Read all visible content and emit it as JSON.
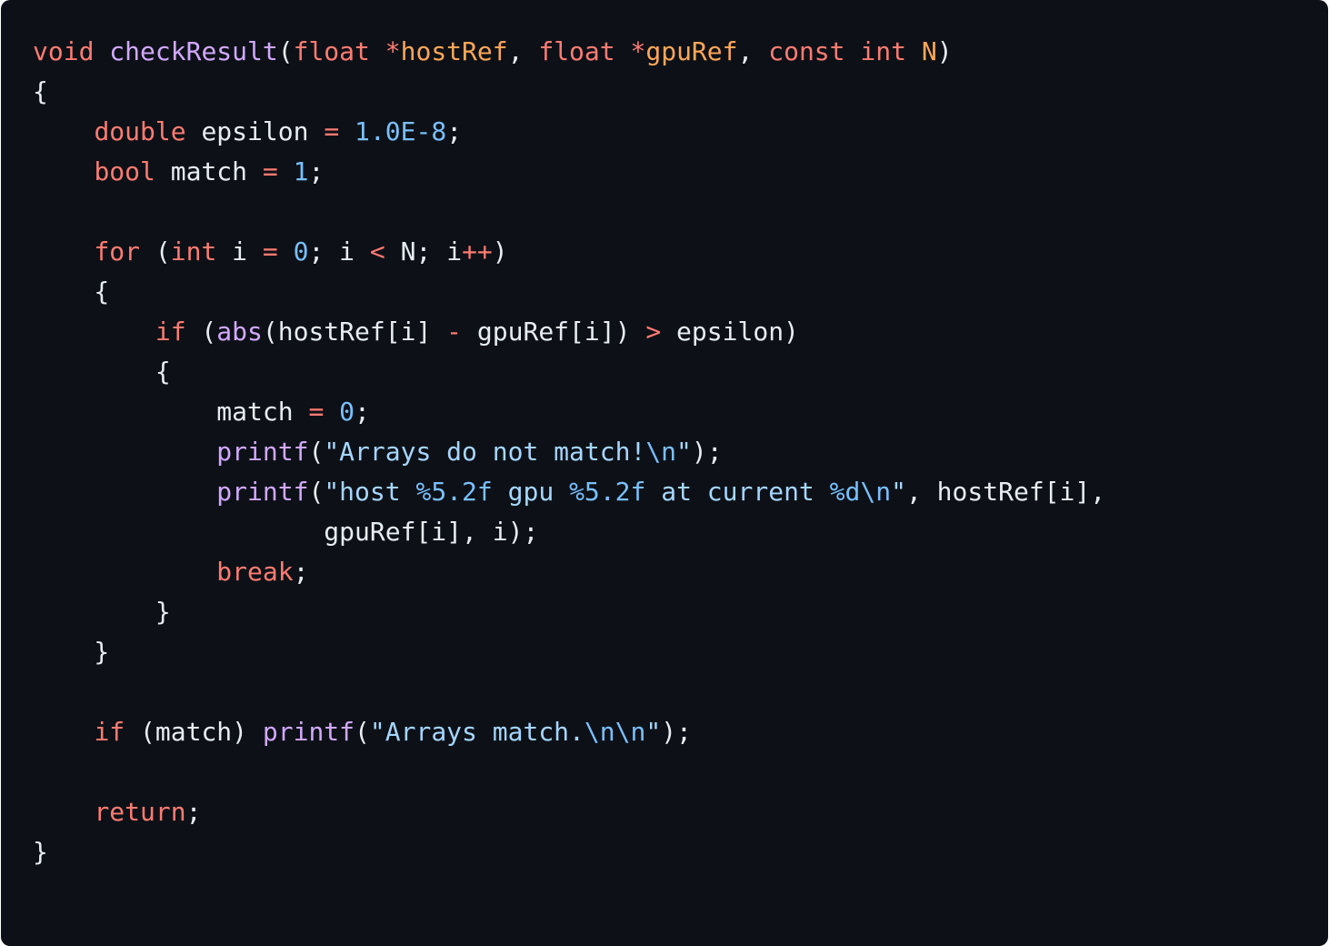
{
  "editor": {
    "language": "c",
    "colors": {
      "background": "#0d1117",
      "plain": "#e6edf3",
      "keyword": "#ff7b72",
      "function": "#d2a8ff",
      "parameter": "#ffa657",
      "number": "#79c0ff",
      "string": "#a5d6ff",
      "operator": "#ff7b72"
    },
    "lines": [
      {
        "tokens": [
          {
            "t": "void",
            "k": "keyword"
          },
          {
            "t": " ",
            "k": "plain"
          },
          {
            "t": "checkResult",
            "k": "function"
          },
          {
            "t": "(",
            "k": "plain"
          },
          {
            "t": "float",
            "k": "keyword"
          },
          {
            "t": " ",
            "k": "plain"
          },
          {
            "t": "*",
            "k": "operator"
          },
          {
            "t": "hostRef",
            "k": "parameter"
          },
          {
            "t": ", ",
            "k": "plain"
          },
          {
            "t": "float",
            "k": "keyword"
          },
          {
            "t": " ",
            "k": "plain"
          },
          {
            "t": "*",
            "k": "operator"
          },
          {
            "t": "gpuRef",
            "k": "parameter"
          },
          {
            "t": ", ",
            "k": "plain"
          },
          {
            "t": "const",
            "k": "keyword"
          },
          {
            "t": " ",
            "k": "plain"
          },
          {
            "t": "int",
            "k": "keyword"
          },
          {
            "t": " ",
            "k": "plain"
          },
          {
            "t": "N",
            "k": "parameter"
          },
          {
            "t": ")",
            "k": "plain"
          }
        ]
      },
      {
        "tokens": [
          {
            "t": "{",
            "k": "plain"
          }
        ]
      },
      {
        "tokens": [
          {
            "t": "    ",
            "k": "plain"
          },
          {
            "t": "double",
            "k": "keyword"
          },
          {
            "t": " epsilon ",
            "k": "plain"
          },
          {
            "t": "=",
            "k": "operator"
          },
          {
            "t": " ",
            "k": "plain"
          },
          {
            "t": "1.0E-8",
            "k": "number"
          },
          {
            "t": ";",
            "k": "plain"
          }
        ]
      },
      {
        "tokens": [
          {
            "t": "    ",
            "k": "plain"
          },
          {
            "t": "bool",
            "k": "keyword"
          },
          {
            "t": " match ",
            "k": "plain"
          },
          {
            "t": "=",
            "k": "operator"
          },
          {
            "t": " ",
            "k": "plain"
          },
          {
            "t": "1",
            "k": "number"
          },
          {
            "t": ";",
            "k": "plain"
          }
        ]
      },
      {
        "tokens": []
      },
      {
        "tokens": [
          {
            "t": "    ",
            "k": "plain"
          },
          {
            "t": "for",
            "k": "keyword"
          },
          {
            "t": " (",
            "k": "plain"
          },
          {
            "t": "int",
            "k": "keyword"
          },
          {
            "t": " i ",
            "k": "plain"
          },
          {
            "t": "=",
            "k": "operator"
          },
          {
            "t": " ",
            "k": "plain"
          },
          {
            "t": "0",
            "k": "number"
          },
          {
            "t": "; i ",
            "k": "plain"
          },
          {
            "t": "<",
            "k": "operator"
          },
          {
            "t": " N; i",
            "k": "plain"
          },
          {
            "t": "++",
            "k": "operator"
          },
          {
            "t": ")",
            "k": "plain"
          }
        ]
      },
      {
        "tokens": [
          {
            "t": "    {",
            "k": "plain"
          }
        ]
      },
      {
        "tokens": [
          {
            "t": "        ",
            "k": "plain"
          },
          {
            "t": "if",
            "k": "keyword"
          },
          {
            "t": " (",
            "k": "plain"
          },
          {
            "t": "abs",
            "k": "function"
          },
          {
            "t": "(hostRef[i] ",
            "k": "plain"
          },
          {
            "t": "-",
            "k": "operator"
          },
          {
            "t": " gpuRef[i]) ",
            "k": "plain"
          },
          {
            "t": ">",
            "k": "operator"
          },
          {
            "t": " epsilon)",
            "k": "plain"
          }
        ]
      },
      {
        "tokens": [
          {
            "t": "        {",
            "k": "plain"
          }
        ]
      },
      {
        "tokens": [
          {
            "t": "            match ",
            "k": "plain"
          },
          {
            "t": "=",
            "k": "operator"
          },
          {
            "t": " ",
            "k": "plain"
          },
          {
            "t": "0",
            "k": "number"
          },
          {
            "t": ";",
            "k": "plain"
          }
        ]
      },
      {
        "tokens": [
          {
            "t": "            ",
            "k": "plain"
          },
          {
            "t": "printf",
            "k": "function"
          },
          {
            "t": "(",
            "k": "plain"
          },
          {
            "t": "\"Arrays do not match!",
            "k": "string"
          },
          {
            "t": "\\n",
            "k": "number"
          },
          {
            "t": "\"",
            "k": "string"
          },
          {
            "t": ");",
            "k": "plain"
          }
        ]
      },
      {
        "tokens": [
          {
            "t": "            ",
            "k": "plain"
          },
          {
            "t": "printf",
            "k": "function"
          },
          {
            "t": "(",
            "k": "plain"
          },
          {
            "t": "\"host ",
            "k": "string"
          },
          {
            "t": "%5.2f",
            "k": "number"
          },
          {
            "t": " gpu ",
            "k": "string"
          },
          {
            "t": "%5.2f",
            "k": "number"
          },
          {
            "t": " at current ",
            "k": "string"
          },
          {
            "t": "%d",
            "k": "number"
          },
          {
            "t": "\\n",
            "k": "number"
          },
          {
            "t": "\"",
            "k": "string"
          },
          {
            "t": ", hostRef[i],",
            "k": "plain"
          }
        ]
      },
      {
        "tokens": [
          {
            "t": "                   gpuRef[i], i);",
            "k": "plain"
          }
        ]
      },
      {
        "tokens": [
          {
            "t": "            ",
            "k": "plain"
          },
          {
            "t": "break",
            "k": "keyword"
          },
          {
            "t": ";",
            "k": "plain"
          }
        ]
      },
      {
        "tokens": [
          {
            "t": "        }",
            "k": "plain"
          }
        ]
      },
      {
        "tokens": [
          {
            "t": "    }",
            "k": "plain"
          }
        ]
      },
      {
        "tokens": []
      },
      {
        "tokens": [
          {
            "t": "    ",
            "k": "plain"
          },
          {
            "t": "if",
            "k": "keyword"
          },
          {
            "t": " (match) ",
            "k": "plain"
          },
          {
            "t": "printf",
            "k": "function"
          },
          {
            "t": "(",
            "k": "plain"
          },
          {
            "t": "\"Arrays match.",
            "k": "string"
          },
          {
            "t": "\\n\\n",
            "k": "number"
          },
          {
            "t": "\"",
            "k": "string"
          },
          {
            "t": ");",
            "k": "plain"
          }
        ]
      },
      {
        "tokens": []
      },
      {
        "tokens": [
          {
            "t": "    ",
            "k": "plain"
          },
          {
            "t": "return",
            "k": "keyword"
          },
          {
            "t": ";",
            "k": "plain"
          }
        ]
      },
      {
        "tokens": [
          {
            "t": "}",
            "k": "plain"
          }
        ]
      }
    ]
  }
}
